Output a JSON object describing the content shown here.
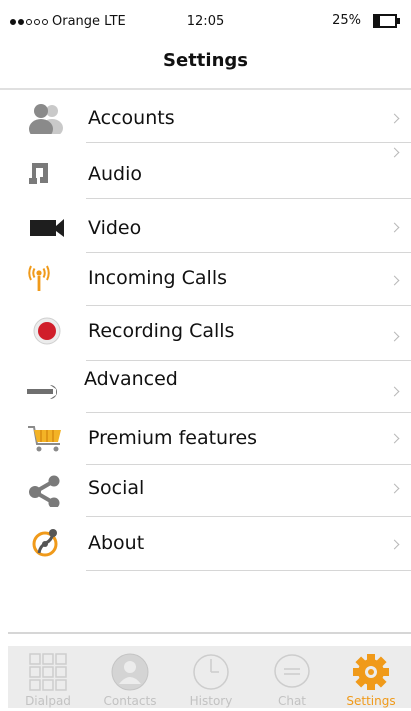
{
  "status": {
    "carrier": "Orange LTE",
    "signal_bars": 2,
    "signal_total": 5,
    "time": "12:05",
    "battery": "25%",
    "battery_level": 0.25
  },
  "header": {
    "title": "Settings"
  },
  "settings_items": [
    {
      "label": "Accounts",
      "icon": "accounts-icon"
    },
    {
      "label": "Audio",
      "icon": "audio-icon"
    },
    {
      "label": "Video",
      "icon": "video-icon"
    },
    {
      "label": "Incoming Calls",
      "icon": "incoming-calls-icon"
    },
    {
      "label": "Recording Calls",
      "icon": "recording-icon"
    },
    {
      "label": "Advanced",
      "icon": "wrench-icon"
    },
    {
      "label": "Premium features",
      "icon": "cart-icon"
    },
    {
      "label": "Social",
      "icon": "share-icon"
    },
    {
      "label": "About",
      "icon": "about-icon"
    }
  ],
  "tabbar": {
    "tabs": [
      {
        "label": "Dialpad",
        "icon": "dialpad-icon",
        "active": false
      },
      {
        "label": "Contacts",
        "icon": "contacts-icon",
        "active": false
      },
      {
        "label": "History",
        "icon": "clock-icon",
        "active": false
      },
      {
        "label": "Chat",
        "icon": "chat-icon",
        "active": false
      },
      {
        "label": "Settings",
        "icon": "gear-icon",
        "active": true
      }
    ]
  },
  "colors": {
    "accent": "#f09a1a",
    "record_red": "#d01e2a",
    "inactive_tab": "#c2c2c2"
  }
}
